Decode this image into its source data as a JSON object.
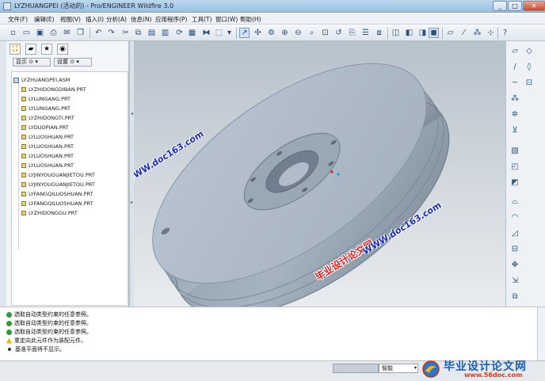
{
  "window": {
    "title": "LYZHUANGPEI (活动的) - Pro/ENGINEER Wildfire 3.0",
    "minimize": "_",
    "maximize": "□",
    "close": "✕"
  },
  "menu": [
    "文件(F)",
    "编辑(E)",
    "视图(V)",
    "插入(I)",
    "分析(A)",
    "信息(N)",
    "应用程序(P)",
    "工具(T)",
    "窗口(W)",
    "帮助(H)"
  ],
  "toolbar": {
    "icons": [
      "new-icon",
      "open-icon",
      "save-icon",
      "print-icon",
      "email-icon",
      "undo-icon",
      "redo-icon",
      "cut-icon",
      "copy-icon",
      "paste-icon",
      "regenerate-icon",
      "find-icon",
      "select-box-icon",
      "repaint-icon",
      "spin-center-icon",
      "orient-icon",
      "zoom-in-icon",
      "zoom-out-icon",
      "refit-icon",
      "reorient-icon",
      "saved-views-icon",
      "layers-icon",
      "wireframe-icon",
      "hidden-line-icon",
      "no-hidden-icon",
      "shading-icon",
      "datum-plane-icon",
      "datum-axis-icon",
      "datum-point-icon",
      "csys-icon",
      "context-help-icon"
    ],
    "dropdown_arrow": "▾"
  },
  "left_panel": {
    "display_label": "显示 ⊙ ▾",
    "settings_label": "设置 ⊙ ▾",
    "tree_root": "LYZHUANGPEI.ASM",
    "tree_items": [
      "LYZHIDONGDIBAN.PRT",
      "LYLUNGANG.PRT",
      "LYLUNGANG.PRT",
      "LYZHIDONGTI.PRT",
      "LYDUOPIAN.PRT",
      "LYLUOSHUAN.PRT",
      "LYLUOSHUAN.PRT",
      "LYLUOSHUAN.PRT",
      "LYLUOSHUAN.PRT",
      "LYJINYOUGUANJIETOU.PRT",
      "LYJINYOUGUANJIETOU.PRT",
      "LYFANGQILUOSHUAN.PRT",
      "LYFANGQILUOSHUAN.PRT",
      "LYZHIDONGGU.PRT"
    ]
  },
  "messages": [
    {
      "type": "info",
      "text": "选取自动类型约束的任意参照。"
    },
    {
      "type": "info",
      "text": "选取自动类型约束的任意参照。"
    },
    {
      "type": "info",
      "text": "选取自动类型约束的任意参照。"
    },
    {
      "type": "warn",
      "text": "重定向此元件作为装配元件。"
    },
    {
      "type": "bullet",
      "text": "基准平面将不显示。"
    }
  ],
  "status": {
    "filter_value": "智能",
    "filter_arrow": "▾"
  },
  "watermarks": {
    "cn": "毕业设计论文网",
    "url": "WWW.doc163.com"
  },
  "brand": {
    "text": "毕业设计论文网",
    "url": "www.56doc.com"
  }
}
